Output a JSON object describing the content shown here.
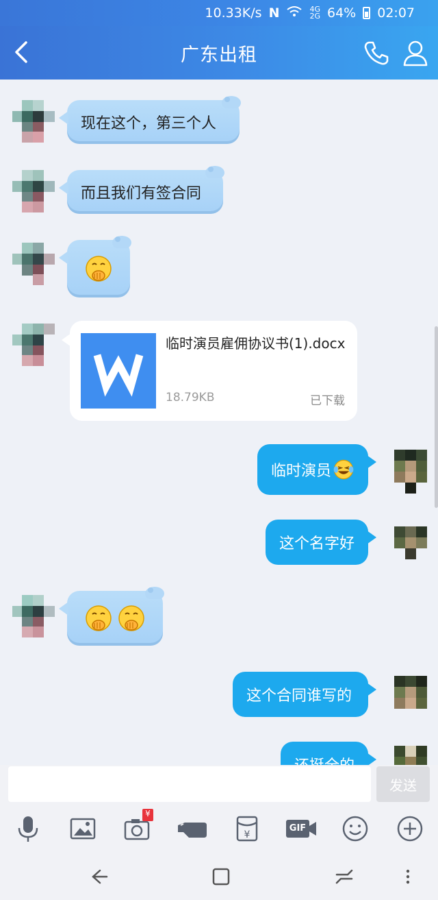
{
  "status_bar": {
    "network_speed": "10.33K/s",
    "signal_labels": "4G 4G 2G",
    "battery": "64%",
    "time": "02:07"
  },
  "header": {
    "title": "广东出租"
  },
  "messages": [
    {
      "side": "in",
      "type": "text",
      "text": "现在这个，第三个人"
    },
    {
      "side": "in",
      "type": "text",
      "text": "而且我们有签合同"
    },
    {
      "side": "in",
      "type": "emoji",
      "emoji": "covering-mouth-emoji"
    },
    {
      "side": "in",
      "type": "file",
      "file_name": "临时演员雇佣协议书(1).docx",
      "file_size": "18.79KB",
      "status": "已下载"
    },
    {
      "side": "out",
      "type": "text",
      "text": "临时演员"
    },
    {
      "side": "out",
      "type": "text",
      "text": "这个名字好"
    },
    {
      "side": "in",
      "type": "emoji",
      "emoji": "covering-mouth-emoji"
    },
    {
      "side": "out",
      "type": "text",
      "text": "这个合同谁写的"
    },
    {
      "side": "out",
      "type": "text",
      "text": "还挺全的"
    }
  ],
  "input": {
    "value": "",
    "send_label": "发送"
  },
  "toolbar": {
    "icons": [
      "microphone-icon",
      "image-icon",
      "camera-icon",
      "hand-gesture-icon",
      "red-packet-icon",
      "gif-icon",
      "smiley-icon",
      "plus-icon"
    ],
    "gif_label": "GIF",
    "yen_label": "¥"
  },
  "colors": {
    "header_gradient_start": "#3a73d6",
    "header_gradient_end": "#39a6f0",
    "incoming_bubble": "#a6d1f7",
    "outgoing_bubble": "#1da9ee",
    "file_icon_blue": "#3f8ef0",
    "background": "#eef1f7"
  }
}
